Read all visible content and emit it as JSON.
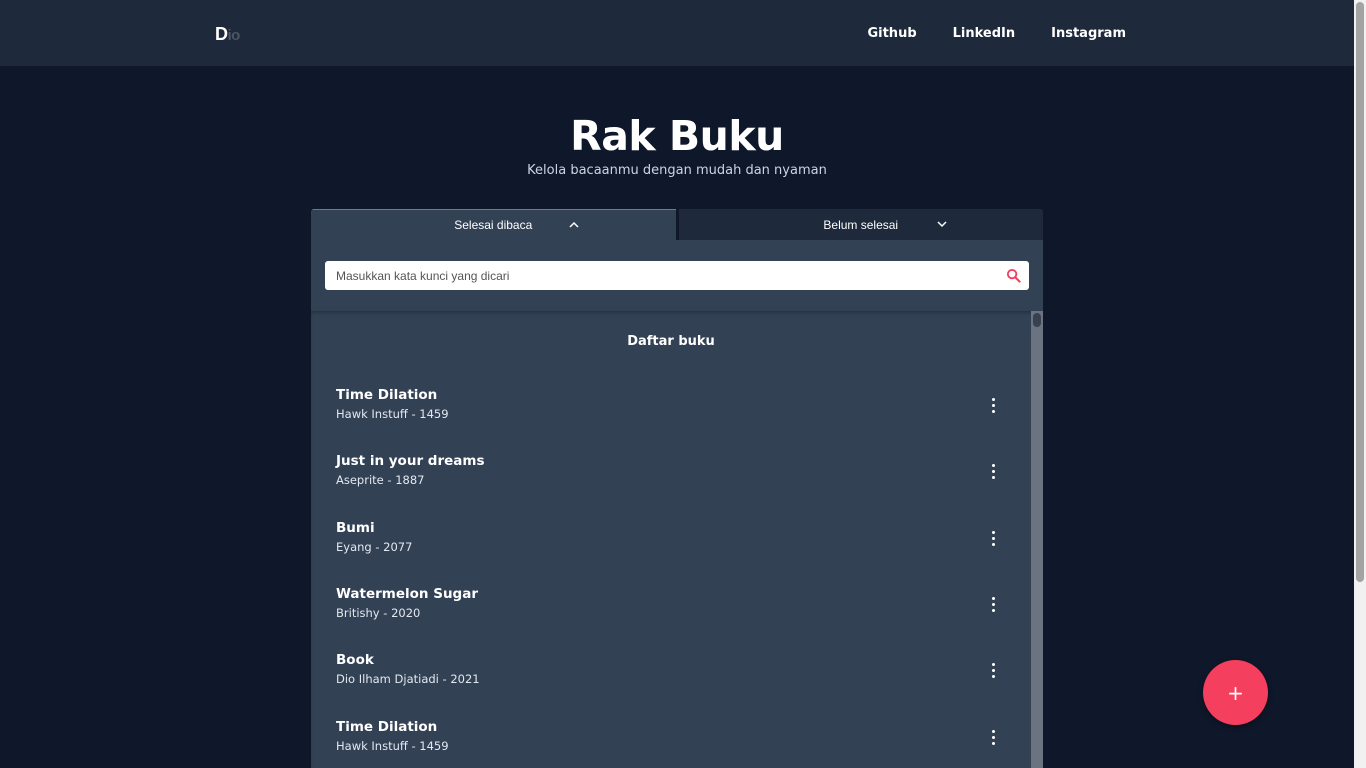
{
  "navbar": {
    "logo_part1": "D",
    "logo_part2": "io",
    "links": [
      "Github",
      "LinkedIn",
      "Instagram"
    ]
  },
  "header": {
    "title": "Rak Buku",
    "subtitle": "Kelola bacaanmu dengan mudah dan nyaman"
  },
  "tabs": [
    {
      "label": "Selesai dibaca",
      "icon": "chevron-up-icon",
      "active": true
    },
    {
      "label": "Belum selesai",
      "icon": "chevron-down-icon",
      "active": false
    }
  ],
  "search": {
    "placeholder": "Masukkan kata kunci yang dicari",
    "value": ""
  },
  "list": {
    "heading": "Daftar buku",
    "books": [
      {
        "title": "Time Dilation",
        "meta": "Hawk Instuff - 1459"
      },
      {
        "title": "Just in your dreams",
        "meta": "Aseprite - 1887"
      },
      {
        "title": "Bumi",
        "meta": "Eyang - 2077"
      },
      {
        "title": "Watermelon Sugar",
        "meta": "Britishy - 2020"
      },
      {
        "title": "Book",
        "meta": "Dio Ilham Djatiadi - 2021"
      },
      {
        "title": "Time Dilation",
        "meta": "Hawk Instuff - 1459"
      }
    ]
  },
  "fab": {
    "label": "+"
  },
  "colors": {
    "background": "#0f172a",
    "navbar": "#1e293b",
    "panel": "#334155",
    "accent": "#f43f5e"
  }
}
